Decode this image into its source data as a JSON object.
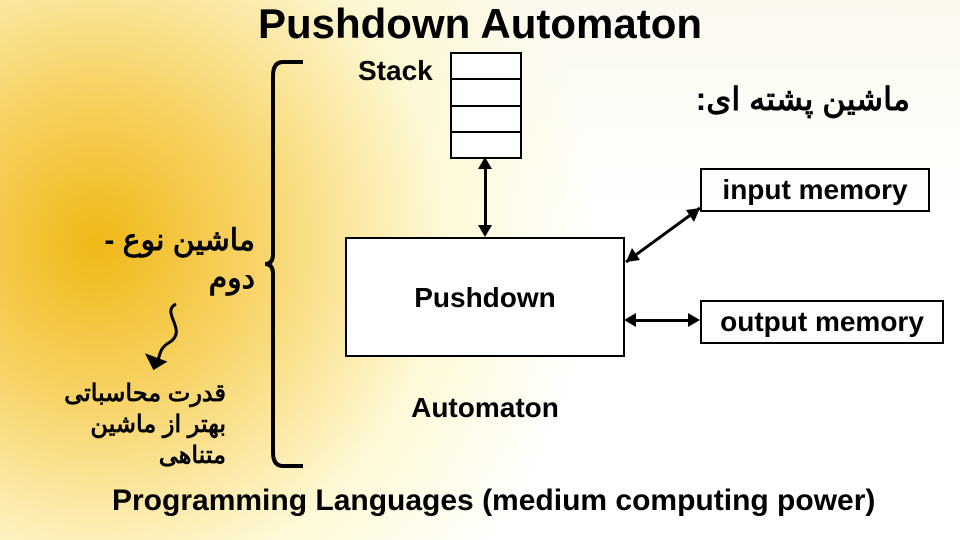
{
  "title": "Pushdown Automaton",
  "stack_label": "Stack",
  "heading_fa": "ماشین پشته ای:",
  "input_memory": "input memory",
  "output_memory": "output memory",
  "pda_box": "Pushdown Automaton",
  "type2": {
    "line1": "ماشین نوع",
    "line2": "دوم"
  },
  "power_note": {
    "line1": "قدرت محاسباتی",
    "line2": "بهتر از ماشین",
    "line3": "متناهی"
  },
  "footer": "Programming Languages  (medium computing power)"
}
